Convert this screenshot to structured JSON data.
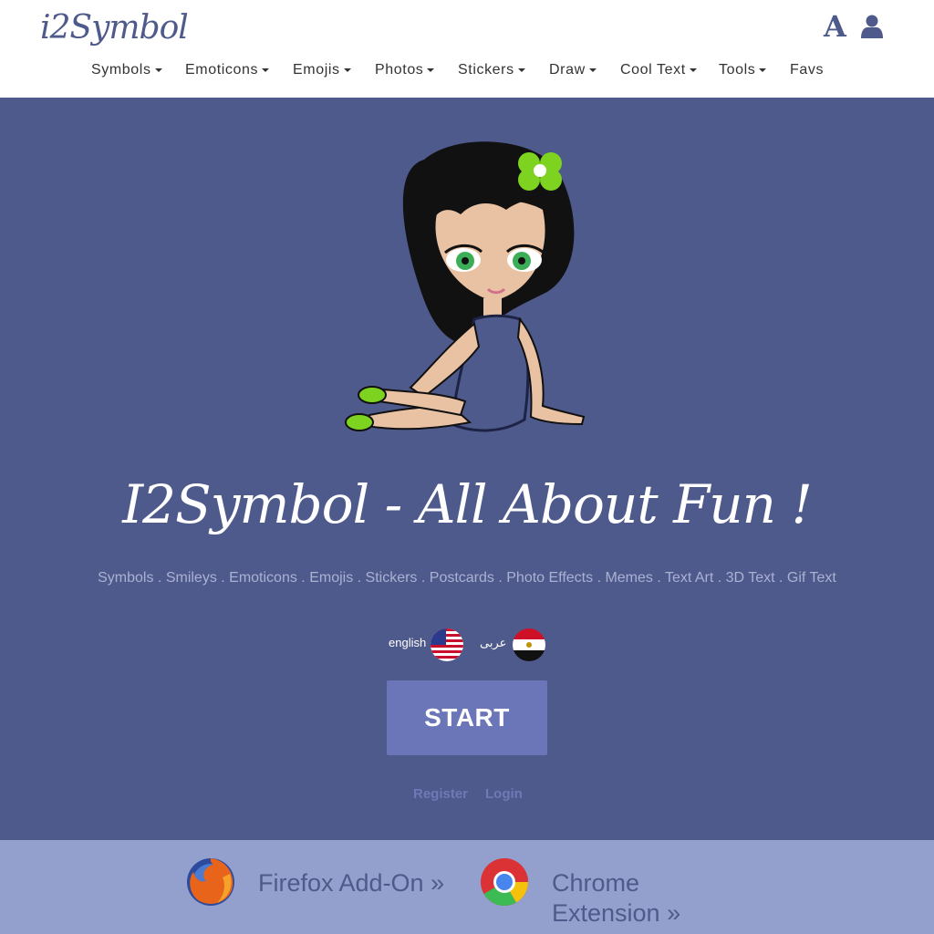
{
  "header": {
    "logo": "i2Symbol",
    "font_icon_glyph": "A",
    "icons": [
      "font-size-icon",
      "user-icon"
    ]
  },
  "nav": {
    "items": [
      {
        "label": "Symbols",
        "dropdown": true
      },
      {
        "label": "Emoticons",
        "dropdown": true
      },
      {
        "label": "Emojis",
        "dropdown": true
      },
      {
        "label": "Photos",
        "dropdown": true
      },
      {
        "label": "Stickers",
        "dropdown": true
      },
      {
        "label": "Draw",
        "dropdown": true
      },
      {
        "label": "Cool Text",
        "dropdown": true
      },
      {
        "label": "Tools",
        "dropdown": true
      },
      {
        "label": "Favs",
        "dropdown": false
      }
    ]
  },
  "hero": {
    "title": "I2Symbol - All About Fun !",
    "subline": "Symbols . Smileys . Emoticons . Emojis . Stickers . Postcards . Photo Effects . Memes . Text Art . 3D Text . Gif Text",
    "languages": [
      {
        "label": "english",
        "flag": "us-flag-icon"
      },
      {
        "label": "عربى",
        "flag": "egypt-flag-icon"
      }
    ],
    "start_label": "START",
    "register_label": "Register",
    "login_label": "Login"
  },
  "addons": {
    "firefox_label": "Firefox Add-On »",
    "chrome_label_line1": "Chrome",
    "chrome_label_line2": "Extension »"
  },
  "colors": {
    "brand": "#4f5a8c",
    "hero_bg": "#4f5a8c",
    "start_button": "#6b76b8",
    "addon_strip": "#939fcc",
    "subline_text": "#aab1d3"
  }
}
